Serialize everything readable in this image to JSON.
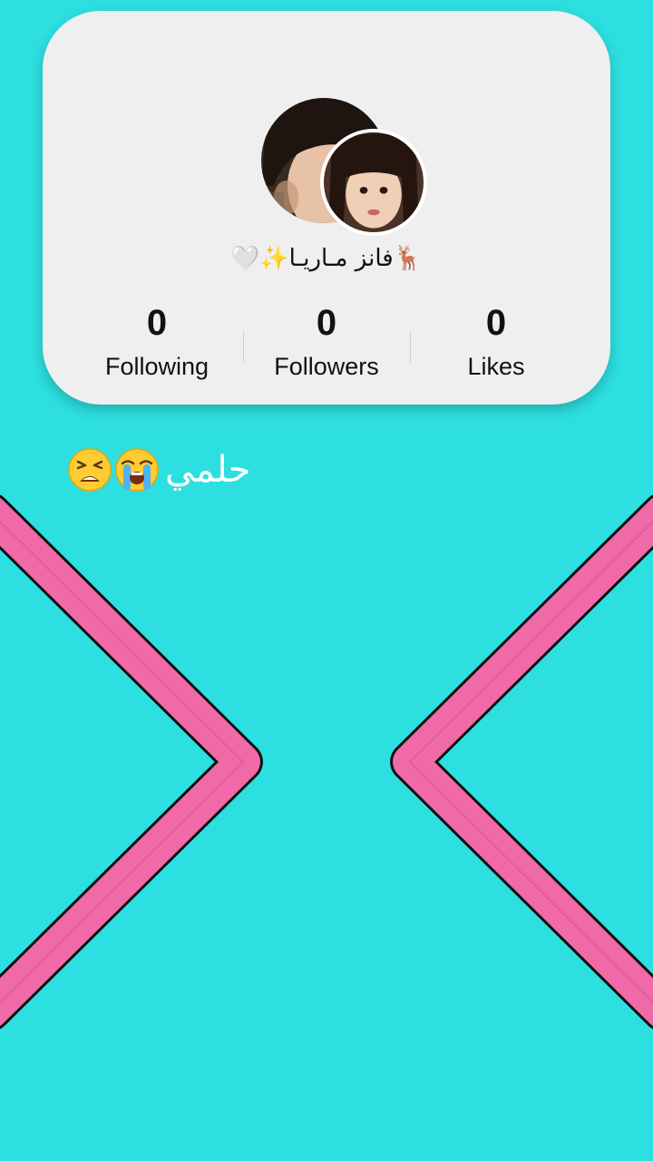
{
  "profile": {
    "username": "🦌فانز مـاريـا✨🤍",
    "stats": [
      {
        "value": "0",
        "label": "Following"
      },
      {
        "value": "0",
        "label": "Followers"
      },
      {
        "value": "0",
        "label": "Likes"
      }
    ],
    "avatar_icons": [
      "child-portrait-photo",
      "child-portrait-photo"
    ]
  },
  "caption": {
    "text": "حلمي",
    "emojis": [
      "tired-face-emoji",
      "loudly-crying-face-emoji"
    ]
  },
  "colors": {
    "background": "#2ddfe0",
    "card": "#efefef",
    "chevron_fill": "#f06aa8",
    "chevron_outline": "#111111",
    "text": "#111111",
    "caption_text": "#ffffff"
  }
}
